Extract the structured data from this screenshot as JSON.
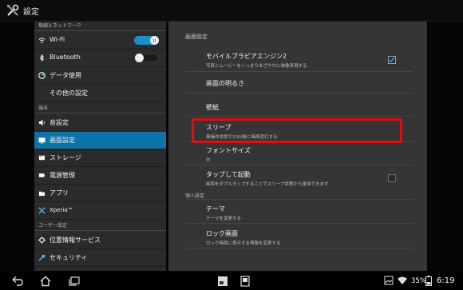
{
  "app": {
    "title": "設定",
    "icon": "settings-tools-icon"
  },
  "sidebar": {
    "sections": [
      {
        "label": "無線とネットワーク"
      },
      {
        "label": "端末"
      },
      {
        "label": "ユーザー設定"
      }
    ],
    "items": [
      {
        "label": "Wi-Fi",
        "icon": "wifi-icon",
        "toggle": "on",
        "toggle_text": "I/O"
      },
      {
        "label": "Bluetooth",
        "icon": "bluetooth-icon",
        "toggle": "off",
        "toggle_text": "O"
      },
      {
        "label": "データ使用",
        "icon": "data-usage-icon"
      },
      {
        "label": "その他の設定",
        "icon": ""
      },
      {
        "label": "音設定",
        "icon": "speaker-icon"
      },
      {
        "label": "画面設定",
        "icon": "display-icon",
        "selected": true
      },
      {
        "label": "ストレージ",
        "icon": "storage-icon"
      },
      {
        "label": "電源管理",
        "icon": "battery-icon"
      },
      {
        "label": "アプリ",
        "icon": "apps-icon"
      },
      {
        "label": "Xperia™",
        "icon": "xperia-icon"
      },
      {
        "label": "位置情報サービス",
        "icon": "location-icon"
      },
      {
        "label": "セキュリティ",
        "icon": "security-icon"
      }
    ]
  },
  "panel": {
    "header": "画面設定",
    "rows": [
      {
        "title": "モバイルブラビアエンジン2",
        "summary": "写真とムービーをくっきりあざやかに映像表現する",
        "checkbox": "checked"
      },
      {
        "title": "画面の明るさ",
        "summary": ""
      },
      {
        "title": "壁紙",
        "summary": ""
      },
      {
        "title": "スリープ",
        "summary": "無操作状態で10分後に画面消灯する",
        "highlighted": true
      },
      {
        "title": "フォントサイズ",
        "summary": "中"
      },
      {
        "title": "タップして起動",
        "summary": "画面をダブルタップすることでスリープ状態から復帰できます",
        "checkbox": "unchecked"
      }
    ],
    "subsection": "個人設定",
    "rows2": [
      {
        "title": "テーマ",
        "summary": "テーマを変更する"
      },
      {
        "title": "ロック画面",
        "summary": "ロック画面に表示する情報を変更する"
      }
    ]
  },
  "navbar": {
    "battery": "35%",
    "time": "6:19",
    "highlight_color": "#e00f0f",
    "accent": "#0e74a8"
  }
}
